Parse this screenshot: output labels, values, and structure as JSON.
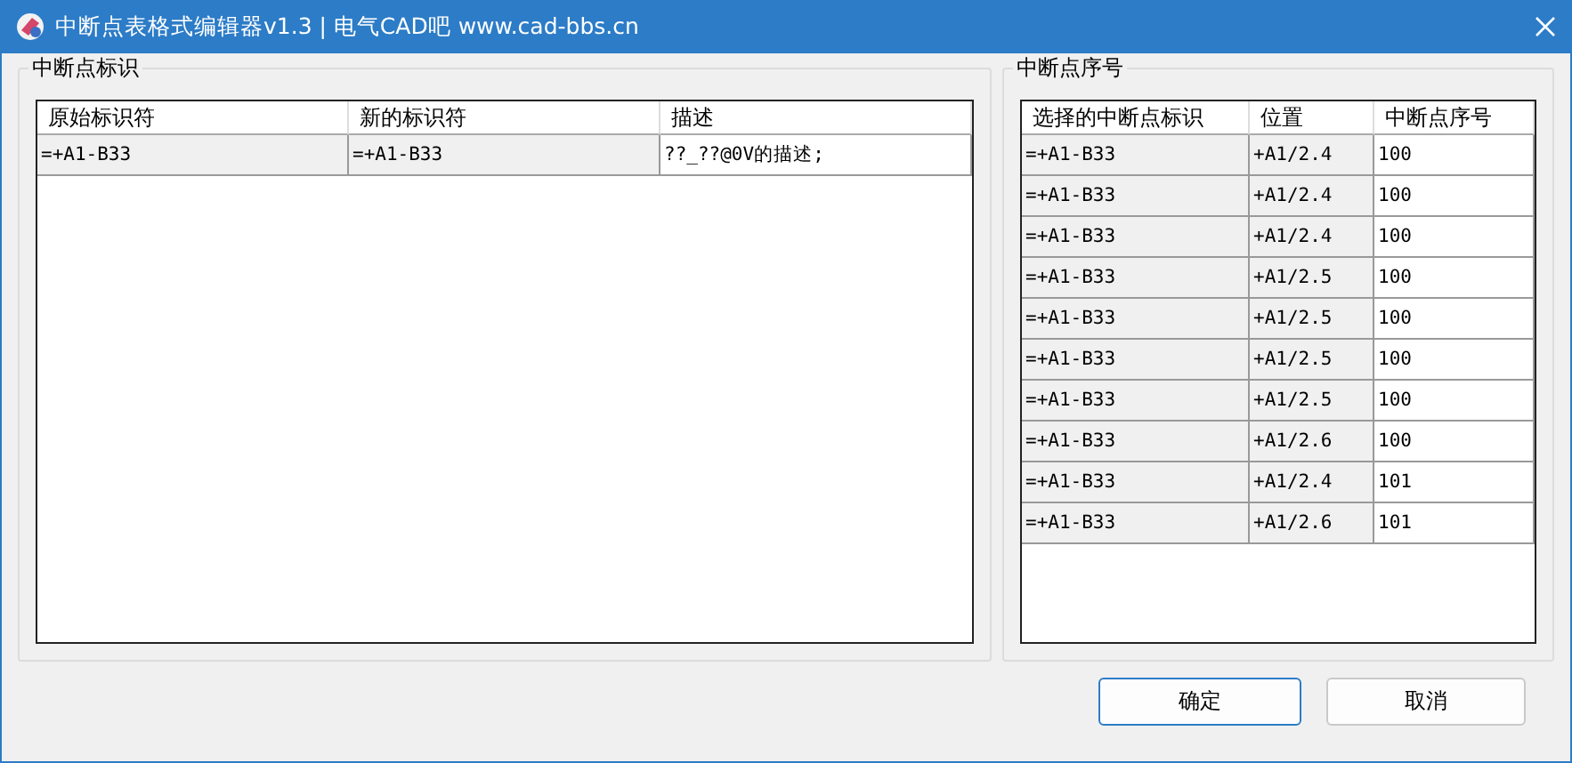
{
  "window": {
    "title": "中断点表格式编辑器v1.3 | 电气CAD吧 www.cad-bbs.cn"
  },
  "left_group": {
    "title": "中断点标识",
    "table": {
      "columns": [
        {
          "label": "原始标识符",
          "readonly": true
        },
        {
          "label": "新的标识符",
          "readonly": true
        },
        {
          "label": "描述",
          "readonly": false
        }
      ],
      "rows": [
        [
          "=+A1-B33",
          "=+A1-B33",
          "??_??@0V的描述;"
        ]
      ]
    }
  },
  "right_group": {
    "title": "中断点序号",
    "table": {
      "columns": [
        {
          "label": "选择的中断点标识",
          "readonly": true
        },
        {
          "label": "位置",
          "readonly": true
        },
        {
          "label": "中断点序号",
          "readonly": false
        }
      ],
      "rows": [
        [
          "=+A1-B33",
          "+A1/2.4",
          "100"
        ],
        [
          "=+A1-B33",
          "+A1/2.4",
          "100"
        ],
        [
          "=+A1-B33",
          "+A1/2.4",
          "100"
        ],
        [
          "=+A1-B33",
          "+A1/2.5",
          "100"
        ],
        [
          "=+A1-B33",
          "+A1/2.5",
          "100"
        ],
        [
          "=+A1-B33",
          "+A1/2.5",
          "100"
        ],
        [
          "=+A1-B33",
          "+A1/2.5",
          "100"
        ],
        [
          "=+A1-B33",
          "+A1/2.6",
          "100"
        ],
        [
          "=+A1-B33",
          "+A1/2.4",
          "101"
        ],
        [
          "=+A1-B33",
          "+A1/2.6",
          "101"
        ]
      ]
    }
  },
  "buttons": [
    {
      "label": "确定",
      "default": true
    },
    {
      "label": "取消",
      "default": false
    }
  ]
}
